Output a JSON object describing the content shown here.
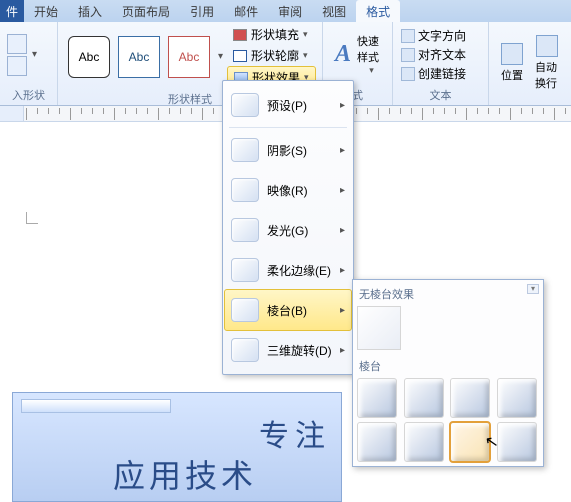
{
  "tabs": {
    "file": "件",
    "home": "开始",
    "insert": "插入",
    "layout": "页面布局",
    "references": "引用",
    "mail": "邮件",
    "review": "审阅",
    "view": "视图",
    "format": "格式"
  },
  "ribbon": {
    "abc1": "Abc",
    "abc2": "Abc",
    "abc3": "Abc",
    "shape_fill": "形状填充",
    "shape_outline": "形状轮廓",
    "shape_effects": "形状效果",
    "insert_shape_label": "入形状",
    "shape_styles_label": "形状样式",
    "wordart_label": "式",
    "quick_styles": "快速样式",
    "text_direction": "文字方向",
    "align_text": "对齐文本",
    "create_link": "创建链接",
    "text_label": "文本",
    "position": "位置",
    "wrap_text": "自动换行"
  },
  "fx_menu": {
    "preset": "预设(P)",
    "shadow": "阴影(S)",
    "reflection": "映像(R)",
    "glow": "发光(G)",
    "soft_edges": "柔化边缘(E)",
    "bevel": "棱台(B)",
    "rotation3d": "三维旋转(D)"
  },
  "bevel": {
    "no_bevel": "无棱台效果",
    "bevel_hdr": "棱台"
  },
  "document": {
    "line1": "专注",
    "line2": "应用技术"
  }
}
